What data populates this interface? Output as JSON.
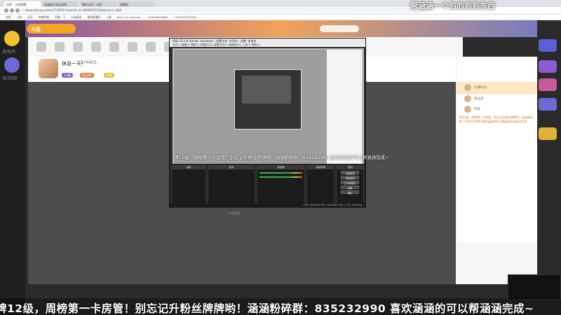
{
  "browser": {
    "tabs": [
      "抖音 - 斗鱼直播",
      "涵涵提示发出游戏",
      "我的主页 - 斗鱼",
      "直播间"
    ],
    "url": "www.douyu.com/174455?dyshid=0-386893513&dyshci=184",
    "bookmarks": [
      "应用",
      "斗鱼",
      "虎牙",
      "哔哩哔哩",
      "百度一下",
      "小说阅读",
      "我的直播间",
      "工具",
      "Bad Guy Launchp..",
      "LEVEL8GAMEN..",
      "LEVELEMOTION..."
    ]
  },
  "header": {
    "logo_text": "斗鱼"
  },
  "rail": {
    "level_top": "6/9/5",
    "level_bottom": "6/399"
  },
  "streamer": {
    "title": "休息一天！",
    "room_id": "174455",
    "badges": [
      "12级",
      "粉丝牌",
      "贵族"
    ]
  },
  "obs": {
    "title": "OBS 25.0.8 (64-bit, windows) - 配置文件: 未命名 - 场景: 未命名",
    "menu": "文件(F)  编辑(E)  视图(V)  停靠窗口(D)  配置文件(P)  场景集合(S)  工具(T)  帮助(H)",
    "caption": "牌12级，周榜第一卡房管！别忘记升粉丝牌牌哟！涵涵粉碎群：835232990 喜欢涵涵的可以帮涵涵完成~",
    "docks": [
      "场景",
      "来源",
      "混音器",
      "场景转换",
      "控制"
    ],
    "controls": [
      "开始推流",
      "开始录制",
      "工作室模式",
      "设置",
      "退出"
    ],
    "status": "LIVE: 00:00:00  REC: 00:00:00  CPU: 3.1%, 30.00 fps"
  },
  "player": {
    "watermark": "斗鱼直播"
  },
  "sidebar": {
    "rows": [
      "主播动态",
      "粉丝团",
      "贵族"
    ],
    "notice": "牌12级，周榜第一卡房管！别忘记升粉丝牌牌哟！涵涵粉碎群：835232990 喜欢涵涵的可以帮涵涵完成每日任务"
  },
  "overlay": {
    "bottom_scroll": "牌12级，周榜第一卡房管！别忘记升粉丝牌牌哟！涵涵粉碎群：835232990 喜欢涵涵的可以帮涵涵完成~",
    "top_scroll": "帮涵涵一个的的到到东西"
  }
}
